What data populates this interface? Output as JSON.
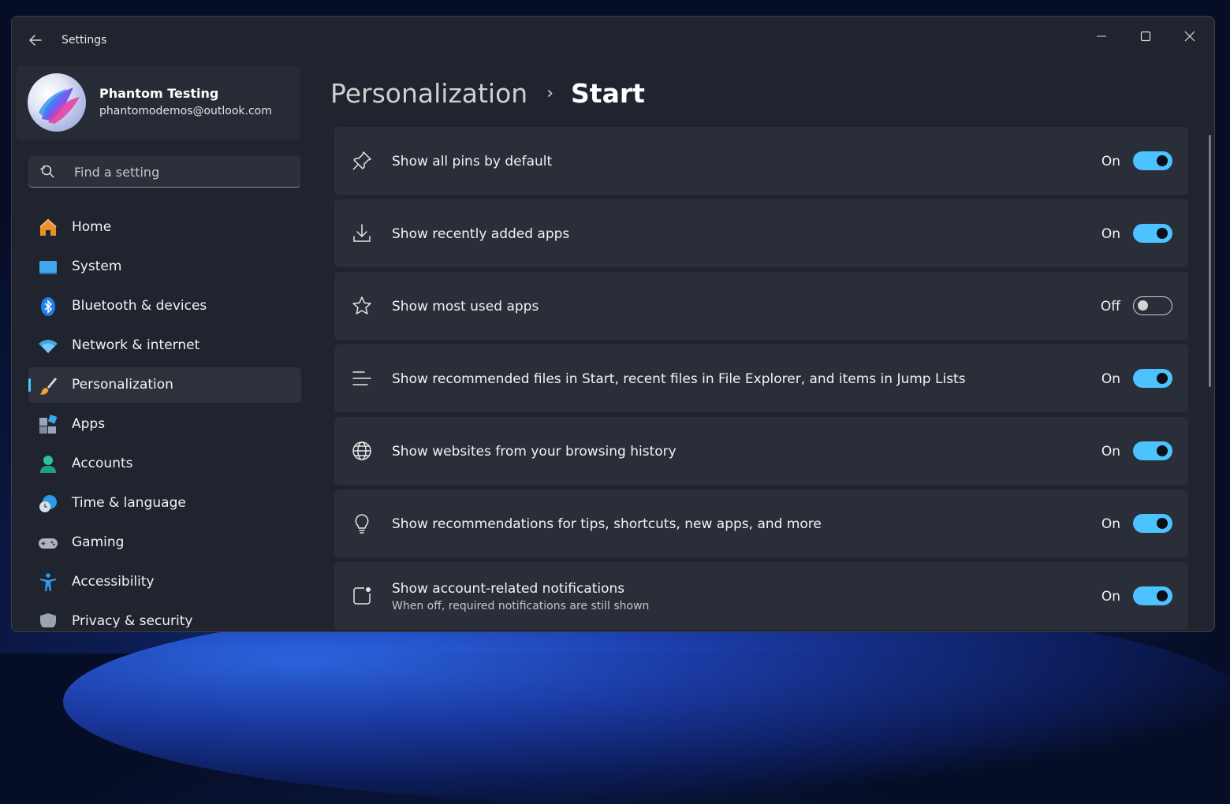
{
  "window": {
    "title": "Settings"
  },
  "profile": {
    "name": "Phantom Testing",
    "email": "phantomodemos@outlook.com"
  },
  "search": {
    "placeholder": "Find a setting"
  },
  "nav": {
    "items": [
      {
        "label": "Home",
        "icon": "home-icon"
      },
      {
        "label": "System",
        "icon": "system-icon"
      },
      {
        "label": "Bluetooth & devices",
        "icon": "bluetooth-icon"
      },
      {
        "label": "Network & internet",
        "icon": "wifi-icon"
      },
      {
        "label": "Personalization",
        "icon": "paintbrush-icon",
        "active": true
      },
      {
        "label": "Apps",
        "icon": "apps-icon"
      },
      {
        "label": "Accounts",
        "icon": "person-icon"
      },
      {
        "label": "Time & language",
        "icon": "clock-globe-icon"
      },
      {
        "label": "Gaming",
        "icon": "gamepad-icon"
      },
      {
        "label": "Accessibility",
        "icon": "accessibility-icon"
      },
      {
        "label": "Privacy & security",
        "icon": "shield-icon"
      }
    ]
  },
  "breadcrumb": {
    "parent": "Personalization",
    "separator": "›",
    "current": "Start"
  },
  "settings": [
    {
      "label": "Show all pins by default",
      "state": "On",
      "on": true,
      "icon": "pin-icon"
    },
    {
      "label": "Show recently added apps",
      "state": "On",
      "on": true,
      "icon": "download-icon"
    },
    {
      "label": "Show most used apps",
      "state": "Off",
      "on": false,
      "icon": "star-icon"
    },
    {
      "label": "Show recommended files in Start, recent files in File Explorer, and items in Jump Lists",
      "state": "On",
      "on": true,
      "icon": "lines-icon"
    },
    {
      "label": "Show websites from your browsing history",
      "state": "On",
      "on": true,
      "icon": "globe-icon"
    },
    {
      "label": "Show recommendations for tips, shortcuts, new apps, and more",
      "state": "On",
      "on": true,
      "icon": "lightbulb-icon"
    },
    {
      "label": "Show account-related notifications",
      "description": "When off, required notifications are still shown",
      "state": "On",
      "on": true,
      "icon": "notification-icon"
    }
  ],
  "colors": {
    "accent": "#4cc2ff",
    "window_bg": "#20242e",
    "card_bg": "#2a2e38"
  }
}
